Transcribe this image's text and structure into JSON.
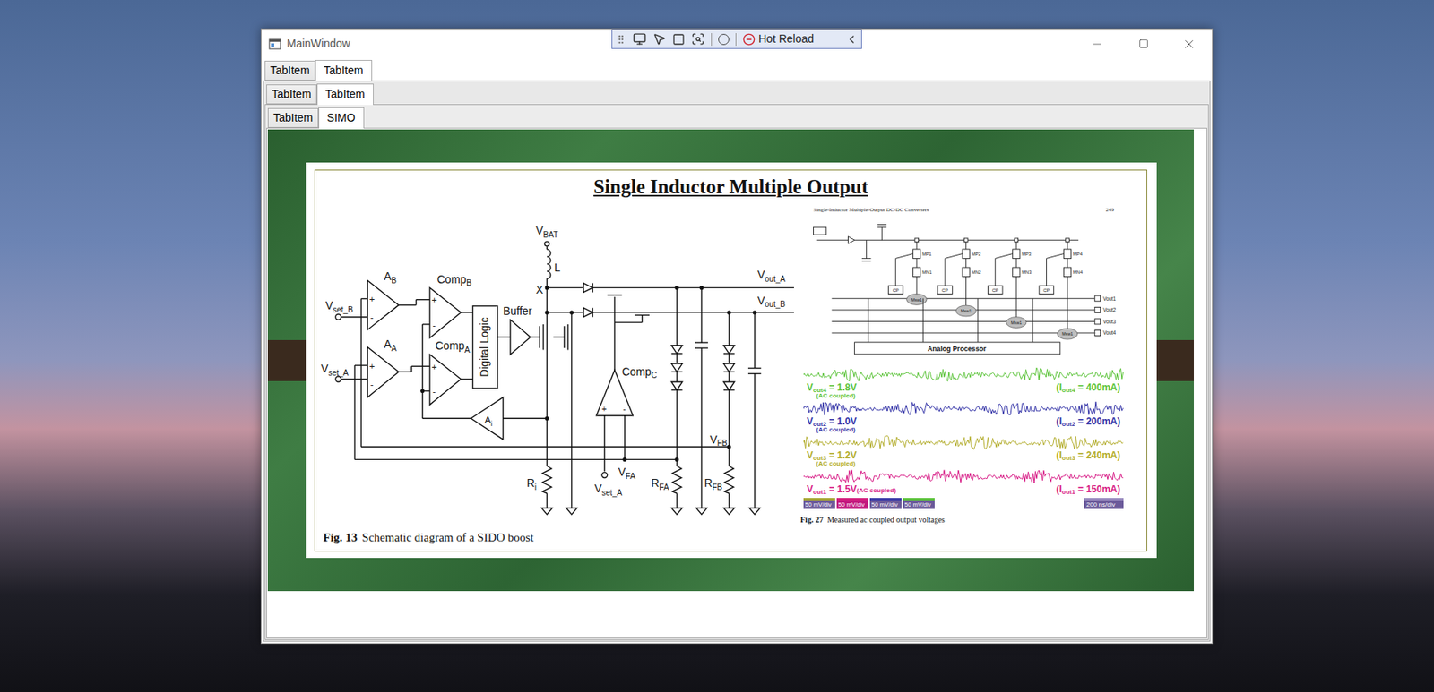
{
  "window": {
    "title": "MainWindow"
  },
  "debug_toolbar": {
    "hot_reload": "Hot Reload"
  },
  "tabs_level1": [
    {
      "label": "TabItem",
      "selected": false
    },
    {
      "label": "TabItem",
      "selected": true
    }
  ],
  "tabs_level2": [
    {
      "label": "TabItem",
      "selected": false
    },
    {
      "label": "TabItem",
      "selected": true
    }
  ],
  "tabs_level3": [
    {
      "label": "TabItem",
      "selected": false
    },
    {
      "label": "SIMO",
      "selected": true
    }
  ],
  "slide": {
    "title": "Single Inductor Multiple Output",
    "schematic": {
      "labels": [
        {
          "main": "V",
          "sub": "BAT"
        },
        {
          "main": "L",
          "sub": ""
        },
        {
          "main": "X",
          "sub": ""
        },
        {
          "main": "V",
          "sub": "out_A"
        },
        {
          "main": "V",
          "sub": "out_B"
        },
        {
          "main": "Comp",
          "sub": "B"
        },
        {
          "main": "A",
          "sub": "B"
        },
        {
          "main": "V",
          "sub": "set_B"
        },
        {
          "main": "A",
          "sub": "A"
        },
        {
          "main": "V",
          "sub": "set_A"
        },
        {
          "main": "Comp",
          "sub": "A"
        },
        {
          "main": "Buffer",
          "sub": ""
        },
        {
          "main": "Digital Logic",
          "sub": ""
        },
        {
          "main": "A",
          "sub": "i"
        },
        {
          "main": "Comp",
          "sub": "C"
        },
        {
          "main": "V",
          "sub": "FB"
        },
        {
          "main": "V",
          "sub": "FA"
        },
        {
          "main": "R",
          "sub": "i"
        },
        {
          "main": "V",
          "sub": "set_A"
        },
        {
          "main": "R",
          "sub": "FA"
        },
        {
          "main": "R",
          "sub": "FB"
        },
        {
          "main": "+",
          "sub": ""
        },
        {
          "main": "-",
          "sub": ""
        },
        {
          "main": "+",
          "sub": ""
        },
        {
          "main": "-",
          "sub": ""
        },
        {
          "main": "+",
          "sub": ""
        },
        {
          "main": "-",
          "sub": ""
        },
        {
          "main": "+",
          "sub": ""
        },
        {
          "main": "-",
          "sub": ""
        },
        {
          "main": "+",
          "sub": ""
        },
        {
          "main": "-",
          "sub": ""
        }
      ],
      "caption_number": "Fig. 13",
      "caption": "Schematic diagram of a SIDO boost"
    },
    "circuit": {
      "header": "Single-Inductor Multiple-Output DC-DC Converters",
      "page": "249",
      "cells": [
        {
          "cp": "CP",
          "p": "MP1",
          "n": "MN1",
          "sw": "Msw1"
        },
        {
          "cp": "CP",
          "p": "MP2",
          "n": "MN2",
          "sw": "Msw1"
        },
        {
          "cp": "CP",
          "p": "MP3",
          "n": "MN3",
          "sw": "Msw1"
        },
        {
          "cp": "CP",
          "p": "MP4",
          "n": "MN4",
          "sw": "Msw1"
        }
      ],
      "outputs": [
        "Vout1",
        "Vout2",
        "Vout3",
        "Vout4"
      ],
      "block": "Analog Processor"
    },
    "scope": {
      "traces": [
        {
          "symbol": "V",
          "sub": "out4",
          "value": " = 1.8V",
          "note": "(AC coupled)",
          "current_symbol": "(I",
          "current_sub": "out4",
          "current_value": " = 400mA)",
          "color": "#5cc43a",
          "kind": "stacked"
        },
        {
          "symbol": "V",
          "sub": "out2",
          "value": " = 1.0V",
          "note": "(AC coupled)",
          "current_symbol": "(I",
          "current_sub": "out2",
          "current_value": " = 200mA)",
          "color": "#3535a8",
          "kind": "stacked"
        },
        {
          "symbol": "V",
          "sub": "out3",
          "value": " = 1.2V",
          "note": "(AC coupled)",
          "current_symbol": "(I",
          "current_sub": "out3",
          "current_value": " = 240mA)",
          "color": "#b3ad2c",
          "kind": "stacked"
        },
        {
          "symbol": "V",
          "sub": "out1",
          "value": " = 1.5V",
          "note": "(AC coupled)",
          "current_symbol": "(I",
          "current_sub": "out1",
          "current_value": " = 150mA)",
          "color": "#d81b86",
          "kind": "inline"
        }
      ],
      "scales": [
        {
          "text": "50 mV/div",
          "color": "#6b5a9a",
          "tag_color": "#a8a832"
        },
        {
          "text": "50 mV/div",
          "color": "#c2187e",
          "tag_color": "#d4207f"
        },
        {
          "text": "50 mV/div",
          "color": "#6b5a9a",
          "tag_color": "#3a3aa8"
        },
        {
          "text": "50 mV/div",
          "color": "#6b5a9a",
          "tag_color": "#5cc43a"
        }
      ],
      "timebase": "200 ns/div",
      "caption_number": "Fig. 27",
      "caption": "Measured ac coupled output voltages"
    }
  }
}
